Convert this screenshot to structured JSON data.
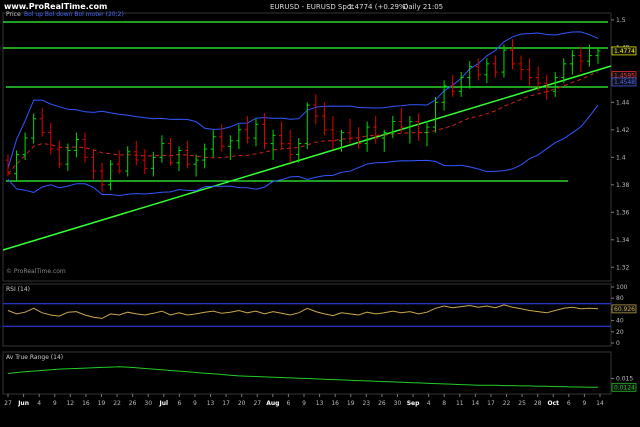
{
  "header": {
    "site": "www.ProRealTime.com",
    "title": "EURUSD - EURUSD Spot",
    "last": "1.4774 (+0.29%)",
    "period": "Daily 21:05"
  },
  "colors": {
    "background": "#000000",
    "up_candle": "#00dd00",
    "down_candle": "#dd0000",
    "bollinger": "#3355ff",
    "trendline": "#33ff33",
    "ma_dashed": "#cc2222",
    "rsi_line": "#c8a84a",
    "atr_line": "#22cc22",
    "level_line": "#3344ff",
    "text": "#bbbbbb"
  },
  "watermark": "© ProRealTime.com",
  "x_ticks": [
    "27",
    "Jun",
    "4",
    "9",
    "12",
    "16",
    "19",
    "22",
    "26",
    "30",
    "Jul",
    "6",
    "9",
    "13",
    "17",
    "20",
    "27",
    "Aug",
    "6",
    "9",
    "13",
    "16",
    "19",
    "23",
    "26",
    "30",
    "Sep",
    "4",
    "8",
    "11",
    "14",
    "17",
    "22",
    "25",
    "28",
    "Oct",
    "6",
    "9",
    "14"
  ],
  "chart_data": [
    {
      "type": "line",
      "title": "Price",
      "legend": "Bol up Bol down Bol moter (20;2)",
      "current_value": "1.4774",
      "value_labels": [
        "1.4774",
        "1.4595",
        "1.4548"
      ],
      "y_ticks": [
        "1.5",
        "1.48",
        "1.46",
        "1.44",
        "1.42",
        "1.4",
        "1.38",
        "1.36",
        "1.34",
        "1.32"
      ],
      "ylim": [
        1.31,
        1.505
      ],
      "candles": [
        [
          1.398,
          1.402,
          1.386,
          1.388
        ],
        [
          1.388,
          1.405,
          1.382,
          1.402
        ],
        [
          1.402,
          1.418,
          1.398,
          1.414
        ],
        [
          1.414,
          1.432,
          1.41,
          1.428
        ],
        [
          1.428,
          1.436,
          1.415,
          1.418
        ],
        [
          1.418,
          1.425,
          1.402,
          1.406
        ],
        [
          1.406,
          1.412,
          1.392,
          1.395
        ],
        [
          1.395,
          1.41,
          1.39,
          1.405
        ],
        [
          1.405,
          1.418,
          1.4,
          1.413
        ],
        [
          1.413,
          1.418,
          1.396,
          1.4
        ],
        [
          1.4,
          1.406,
          1.384,
          1.39
        ],
        [
          1.39,
          1.396,
          1.375,
          1.38
        ],
        [
          1.38,
          1.398,
          1.376,
          1.395
        ],
        [
          1.395,
          1.405,
          1.388,
          1.39
        ],
        [
          1.39,
          1.408,
          1.386,
          1.404
        ],
        [
          1.404,
          1.412,
          1.394,
          1.398
        ],
        [
          1.398,
          1.406,
          1.388,
          1.392
        ],
        [
          1.392,
          1.404,
          1.386,
          1.4
        ],
        [
          1.4,
          1.416,
          1.396,
          1.41
        ],
        [
          1.41,
          1.414,
          1.394,
          1.396
        ],
        [
          1.396,
          1.408,
          1.39,
          1.405
        ],
        [
          1.405,
          1.412,
          1.392,
          1.395
        ],
        [
          1.395,
          1.402,
          1.386,
          1.398
        ],
        [
          1.398,
          1.41,
          1.392,
          1.406
        ],
        [
          1.406,
          1.42,
          1.4,
          1.415
        ],
        [
          1.415,
          1.424,
          1.404,
          1.408
        ],
        [
          1.408,
          1.416,
          1.398,
          1.412
        ],
        [
          1.412,
          1.424,
          1.406,
          1.42
        ],
        [
          1.42,
          1.43,
          1.41,
          1.414
        ],
        [
          1.414,
          1.428,
          1.408,
          1.424
        ],
        [
          1.424,
          1.432,
          1.406,
          1.41
        ],
        [
          1.41,
          1.42,
          1.398,
          1.416
        ],
        [
          1.416,
          1.426,
          1.406,
          1.41
        ],
        [
          1.41,
          1.42,
          1.396,
          1.402
        ],
        [
          1.402,
          1.414,
          1.396,
          1.41
        ],
        [
          1.41,
          1.44,
          1.406,
          1.438
        ],
        [
          1.438,
          1.446,
          1.424,
          1.43
        ],
        [
          1.43,
          1.44,
          1.416,
          1.42
        ],
        [
          1.42,
          1.43,
          1.406,
          1.412
        ],
        [
          1.412,
          1.42,
          1.404,
          1.418
        ],
        [
          1.418,
          1.428,
          1.41,
          1.414
        ],
        [
          1.414,
          1.422,
          1.406,
          1.41
        ],
        [
          1.41,
          1.426,
          1.404,
          1.422
        ],
        [
          1.422,
          1.43,
          1.41,
          1.414
        ],
        [
          1.414,
          1.42,
          1.404,
          1.418
        ],
        [
          1.418,
          1.43,
          1.414,
          1.426
        ],
        [
          1.426,
          1.436,
          1.418,
          1.422
        ],
        [
          1.422,
          1.43,
          1.41,
          1.426
        ],
        [
          1.426,
          1.432,
          1.412,
          1.418
        ],
        [
          1.418,
          1.426,
          1.408,
          1.422
        ],
        [
          1.422,
          1.444,
          1.418,
          1.44
        ],
        [
          1.44,
          1.456,
          1.434,
          1.452
        ],
        [
          1.452,
          1.46,
          1.444,
          1.448
        ],
        [
          1.448,
          1.462,
          1.444,
          1.458
        ],
        [
          1.458,
          1.47,
          1.45,
          1.466
        ],
        [
          1.466,
          1.472,
          1.456,
          1.46
        ],
        [
          1.46,
          1.472,
          1.454,
          1.468
        ],
        [
          1.468,
          1.474,
          1.458,
          1.462
        ],
        [
          1.462,
          1.482,
          1.458,
          1.478
        ],
        [
          1.478,
          1.486,
          1.464,
          1.468
        ],
        [
          1.468,
          1.474,
          1.456,
          1.464
        ],
        [
          1.464,
          1.472,
          1.452,
          1.458
        ],
        [
          1.458,
          1.466,
          1.448,
          1.454
        ],
        [
          1.454,
          1.46,
          1.442,
          1.448
        ],
        [
          1.448,
          1.462,
          1.444,
          1.458
        ],
        [
          1.458,
          1.472,
          1.454,
          1.468
        ],
        [
          1.468,
          1.478,
          1.46,
          1.474
        ],
        [
          1.474,
          1.48,
          1.462,
          1.47
        ],
        [
          1.47,
          1.482,
          1.466,
          1.474
        ],
        [
          1.474,
          1.48,
          1.468,
          1.4774
        ]
      ]
    },
    {
      "type": "line",
      "title": "RSI (14)",
      "current_value": "60.926",
      "y_ticks": [
        "100",
        "80",
        "60",
        "40",
        "20",
        "0"
      ],
      "ylim": [
        0,
        100
      ],
      "levels": [
        70,
        30
      ],
      "values": [
        58,
        52,
        55,
        62,
        54,
        50,
        48,
        55,
        56,
        50,
        46,
        44,
        52,
        50,
        55,
        52,
        50,
        53,
        57,
        50,
        54,
        50,
        52,
        55,
        57,
        53,
        55,
        58,
        54,
        57,
        52,
        56,
        53,
        50,
        54,
        62,
        56,
        52,
        49,
        54,
        52,
        50,
        55,
        52,
        54,
        57,
        54,
        56,
        52,
        55,
        62,
        66,
        63,
        65,
        67,
        64,
        66,
        63,
        68,
        64,
        61,
        58,
        56,
        54,
        58,
        62,
        64,
        61,
        62,
        61
      ]
    },
    {
      "type": "line",
      "title": "Av True Range (14)",
      "current_value": "0.0124",
      "y_ticks": [
        "0.015"
      ],
      "ylim": [
        0.011,
        0.022
      ],
      "values": [
        0.0165,
        0.0168,
        0.017,
        0.0172,
        0.0174,
        0.0176,
        0.0178,
        0.0179,
        0.018,
        0.0181,
        0.0182,
        0.0183,
        0.0184,
        0.0185,
        0.0184,
        0.0182,
        0.018,
        0.0178,
        0.0176,
        0.0174,
        0.0172,
        0.017,
        0.0168,
        0.0166,
        0.0164,
        0.0162,
        0.016,
        0.0158,
        0.0157,
        0.0156,
        0.0155,
        0.0154,
        0.0153,
        0.0152,
        0.0151,
        0.015,
        0.0149,
        0.0148,
        0.0147,
        0.0146,
        0.0145,
        0.0144,
        0.0143,
        0.0142,
        0.0141,
        0.014,
        0.0139,
        0.0138,
        0.0137,
        0.0136,
        0.0135,
        0.0134,
        0.0133,
        0.0132,
        0.0131,
        0.013,
        0.013,
        0.013,
        0.0129,
        0.0129,
        0.0128,
        0.0128,
        0.0127,
        0.0127,
        0.0126,
        0.0126,
        0.0125,
        0.0125,
        0.0124,
        0.0124
      ]
    }
  ]
}
